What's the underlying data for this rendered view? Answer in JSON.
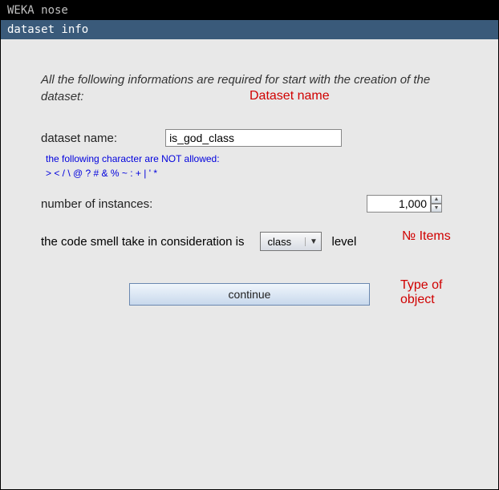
{
  "window": {
    "title": "WEKA nose",
    "subtitle": "dataset info"
  },
  "intro": "All the following informations are required for start with the creation of the dataset:",
  "fields": {
    "datasetName": {
      "label": "dataset name:",
      "value": "is_god_class",
      "warn_line1": "the following character are NOT allowed:",
      "warn_line2": ">  <  /  \\  @  ?  #  &  %  ~  :  +  |  '  *"
    },
    "instances": {
      "label": "number of instances:",
      "value": "1,000"
    },
    "level": {
      "prefix": "the code smell take in consideration is",
      "selected": "class",
      "suffix": "level"
    }
  },
  "buttons": {
    "continue": "continue"
  },
  "annotations": {
    "datasetName": "Dataset name",
    "items": "№ Items",
    "typeOfObject": "Type of\nobject"
  }
}
